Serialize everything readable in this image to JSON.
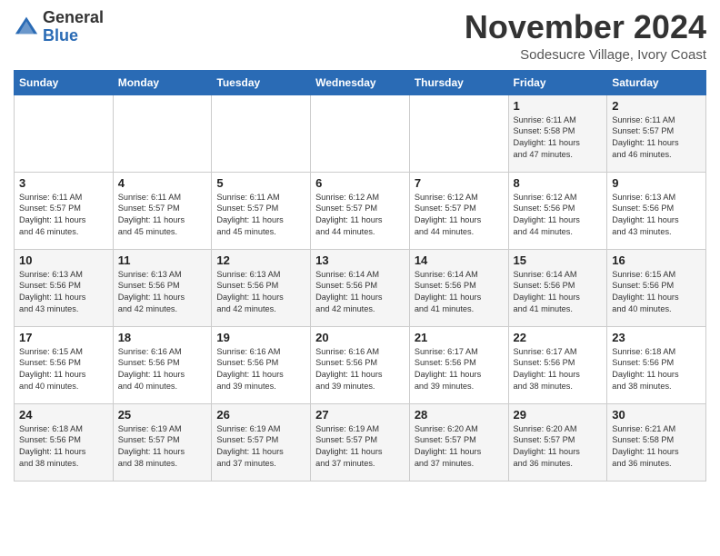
{
  "header": {
    "logo": {
      "general": "General",
      "blue": "Blue"
    },
    "title": "November 2024",
    "location": "Sodesucre Village, Ivory Coast"
  },
  "calendar": {
    "days_of_week": [
      "Sunday",
      "Monday",
      "Tuesday",
      "Wednesday",
      "Thursday",
      "Friday",
      "Saturday"
    ],
    "weeks": [
      [
        {
          "day": "",
          "info": ""
        },
        {
          "day": "",
          "info": ""
        },
        {
          "day": "",
          "info": ""
        },
        {
          "day": "",
          "info": ""
        },
        {
          "day": "",
          "info": ""
        },
        {
          "day": "1",
          "info": "Sunrise: 6:11 AM\nSunset: 5:58 PM\nDaylight: 11 hours\nand 47 minutes."
        },
        {
          "day": "2",
          "info": "Sunrise: 6:11 AM\nSunset: 5:57 PM\nDaylight: 11 hours\nand 46 minutes."
        }
      ],
      [
        {
          "day": "3",
          "info": "Sunrise: 6:11 AM\nSunset: 5:57 PM\nDaylight: 11 hours\nand 46 minutes."
        },
        {
          "day": "4",
          "info": "Sunrise: 6:11 AM\nSunset: 5:57 PM\nDaylight: 11 hours\nand 45 minutes."
        },
        {
          "day": "5",
          "info": "Sunrise: 6:11 AM\nSunset: 5:57 PM\nDaylight: 11 hours\nand 45 minutes."
        },
        {
          "day": "6",
          "info": "Sunrise: 6:12 AM\nSunset: 5:57 PM\nDaylight: 11 hours\nand 44 minutes."
        },
        {
          "day": "7",
          "info": "Sunrise: 6:12 AM\nSunset: 5:57 PM\nDaylight: 11 hours\nand 44 minutes."
        },
        {
          "day": "8",
          "info": "Sunrise: 6:12 AM\nSunset: 5:56 PM\nDaylight: 11 hours\nand 44 minutes."
        },
        {
          "day": "9",
          "info": "Sunrise: 6:13 AM\nSunset: 5:56 PM\nDaylight: 11 hours\nand 43 minutes."
        }
      ],
      [
        {
          "day": "10",
          "info": "Sunrise: 6:13 AM\nSunset: 5:56 PM\nDaylight: 11 hours\nand 43 minutes."
        },
        {
          "day": "11",
          "info": "Sunrise: 6:13 AM\nSunset: 5:56 PM\nDaylight: 11 hours\nand 42 minutes."
        },
        {
          "day": "12",
          "info": "Sunrise: 6:13 AM\nSunset: 5:56 PM\nDaylight: 11 hours\nand 42 minutes."
        },
        {
          "day": "13",
          "info": "Sunrise: 6:14 AM\nSunset: 5:56 PM\nDaylight: 11 hours\nand 42 minutes."
        },
        {
          "day": "14",
          "info": "Sunrise: 6:14 AM\nSunset: 5:56 PM\nDaylight: 11 hours\nand 41 minutes."
        },
        {
          "day": "15",
          "info": "Sunrise: 6:14 AM\nSunset: 5:56 PM\nDaylight: 11 hours\nand 41 minutes."
        },
        {
          "day": "16",
          "info": "Sunrise: 6:15 AM\nSunset: 5:56 PM\nDaylight: 11 hours\nand 40 minutes."
        }
      ],
      [
        {
          "day": "17",
          "info": "Sunrise: 6:15 AM\nSunset: 5:56 PM\nDaylight: 11 hours\nand 40 minutes."
        },
        {
          "day": "18",
          "info": "Sunrise: 6:16 AM\nSunset: 5:56 PM\nDaylight: 11 hours\nand 40 minutes."
        },
        {
          "day": "19",
          "info": "Sunrise: 6:16 AM\nSunset: 5:56 PM\nDaylight: 11 hours\nand 39 minutes."
        },
        {
          "day": "20",
          "info": "Sunrise: 6:16 AM\nSunset: 5:56 PM\nDaylight: 11 hours\nand 39 minutes."
        },
        {
          "day": "21",
          "info": "Sunrise: 6:17 AM\nSunset: 5:56 PM\nDaylight: 11 hours\nand 39 minutes."
        },
        {
          "day": "22",
          "info": "Sunrise: 6:17 AM\nSunset: 5:56 PM\nDaylight: 11 hours\nand 38 minutes."
        },
        {
          "day": "23",
          "info": "Sunrise: 6:18 AM\nSunset: 5:56 PM\nDaylight: 11 hours\nand 38 minutes."
        }
      ],
      [
        {
          "day": "24",
          "info": "Sunrise: 6:18 AM\nSunset: 5:56 PM\nDaylight: 11 hours\nand 38 minutes."
        },
        {
          "day": "25",
          "info": "Sunrise: 6:19 AM\nSunset: 5:57 PM\nDaylight: 11 hours\nand 38 minutes."
        },
        {
          "day": "26",
          "info": "Sunrise: 6:19 AM\nSunset: 5:57 PM\nDaylight: 11 hours\nand 37 minutes."
        },
        {
          "day": "27",
          "info": "Sunrise: 6:19 AM\nSunset: 5:57 PM\nDaylight: 11 hours\nand 37 minutes."
        },
        {
          "day": "28",
          "info": "Sunrise: 6:20 AM\nSunset: 5:57 PM\nDaylight: 11 hours\nand 37 minutes."
        },
        {
          "day": "29",
          "info": "Sunrise: 6:20 AM\nSunset: 5:57 PM\nDaylight: 11 hours\nand 36 minutes."
        },
        {
          "day": "30",
          "info": "Sunrise: 6:21 AM\nSunset: 5:58 PM\nDaylight: 11 hours\nand 36 minutes."
        }
      ]
    ]
  }
}
